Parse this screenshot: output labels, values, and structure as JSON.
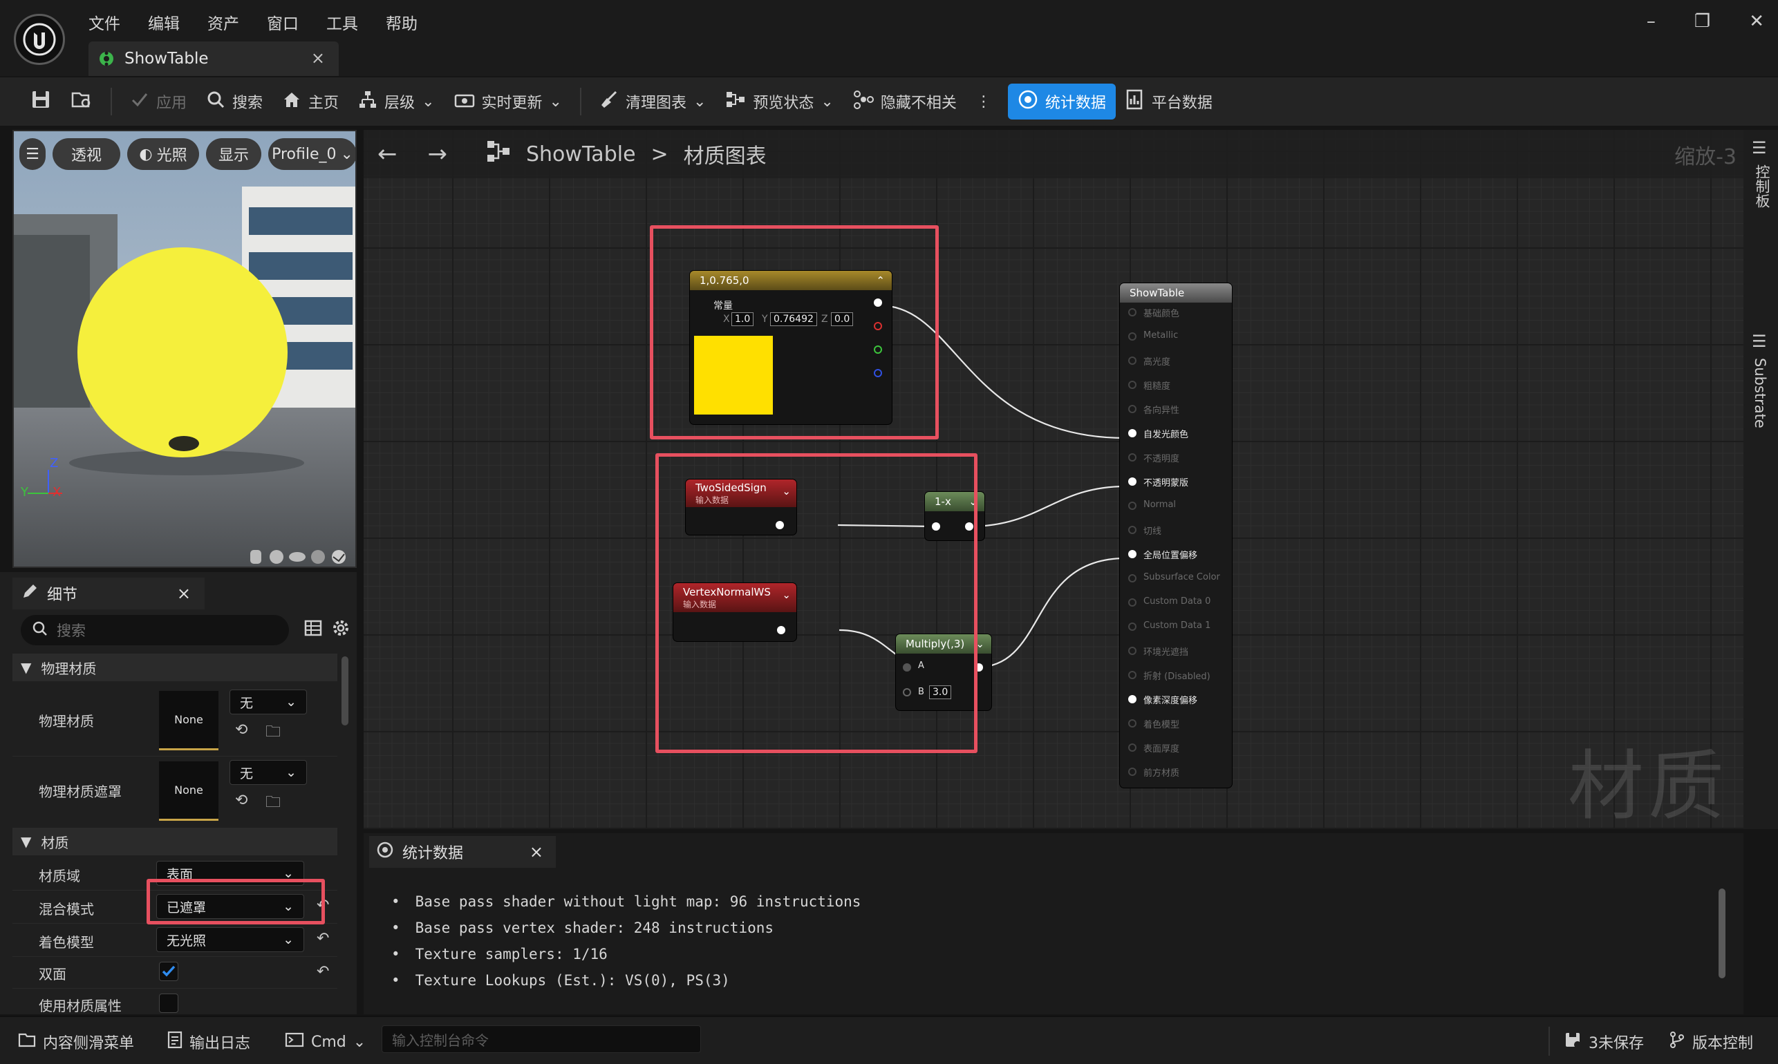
{
  "app": {
    "title": "ShowTable"
  },
  "menu": [
    "文件",
    "编辑",
    "资产",
    "窗口",
    "工具",
    "帮助"
  ],
  "toolbar": {
    "apply": "应用",
    "search": "搜索",
    "home": "主页",
    "hierarchy": "层级",
    "live_update": "实时更新",
    "clean_graph": "清理图表",
    "preview_state": "预览状态",
    "hide_unrelated": "隐藏不相关",
    "stats": "统计数据",
    "platform_stats": "平台数据"
  },
  "viewport": {
    "perspective": "透视",
    "lighting": "光照",
    "show": "显示",
    "profile": "Profile_0",
    "axes": {
      "z": "Z",
      "y": "Y",
      "x": "X"
    }
  },
  "details": {
    "tab": "细节",
    "search_placeholder": "搜索",
    "physical_section": "物理材质",
    "phys_mat_label": "物理材质",
    "phys_mat_value": "None",
    "phys_mat_option": "无",
    "phys_mask_label": "物理材质遮罩",
    "phys_mask_value": "None",
    "phys_mask_option": "无",
    "material_section": "材质",
    "domain_label": "材质域",
    "domain_value": "表面",
    "blend_label": "混合模式",
    "blend_value": "已遮罩",
    "shading_label": "着色模型",
    "shading_value": "无光照",
    "two_sided_label": "双面",
    "two_sided": true,
    "use_attrs_label": "使用材质属性"
  },
  "graph": {
    "breadcrumb_root": "ShowTable",
    "breadcrumb_sep": ">",
    "breadcrumb_leaf": "材质图表",
    "zoom": "缩放-3",
    "watermark": "材质",
    "constant_node": {
      "title": "1,0.765,0",
      "label": "常量",
      "x_label": "X",
      "x": "1.0",
      "y_label": "Y",
      "y": "0.76492",
      "z_label": "Z",
      "z": "0.0",
      "color": "#ffe000"
    },
    "twosided_node": {
      "title": "TwoSidedSign",
      "sub": "输入数据"
    },
    "vertexnormal_node": {
      "title": "VertexNormalWS",
      "sub": "输入数据"
    },
    "oneminus_node": {
      "title": "1-x"
    },
    "multiply_node": {
      "title": "Multiply(,3)",
      "a": "A",
      "b": "B",
      "b_value": "3.0"
    },
    "result_node": {
      "title": "ShowTable",
      "pins": [
        {
          "label": "基础颜色",
          "active": false
        },
        {
          "label": "Metallic",
          "active": false
        },
        {
          "label": "高光度",
          "active": false
        },
        {
          "label": "粗糙度",
          "active": false
        },
        {
          "label": "各向异性",
          "active": false
        },
        {
          "label": "自发光颜色",
          "active": true
        },
        {
          "label": "不透明度",
          "active": false
        },
        {
          "label": "不透明蒙版",
          "active": true
        },
        {
          "label": "Normal",
          "active": false
        },
        {
          "label": "切线",
          "active": false
        },
        {
          "label": "全局位置偏移",
          "active": true
        },
        {
          "label": "Subsurface Color",
          "active": false
        },
        {
          "label": "Custom Data 0",
          "active": false
        },
        {
          "label": "Custom Data 1",
          "active": false
        },
        {
          "label": "环境光遮挡",
          "active": false
        },
        {
          "label": "折射 (Disabled)",
          "active": false
        },
        {
          "label": "像素深度偏移",
          "active": true
        },
        {
          "label": "着色模型",
          "active": false
        },
        {
          "label": "表面厚度",
          "active": false
        },
        {
          "label": "前方材质",
          "active": false
        }
      ]
    }
  },
  "side_tabs": {
    "palette": "控制板",
    "substrate": "Substrate"
  },
  "stats": {
    "tab": "统计数据",
    "lines": [
      "Base pass shader without light map: 96 instructions",
      "Base pass vertex shader: 248 instructions",
      "Texture samplers: 1/16",
      "Texture Lookups (Est.): VS(0), PS(3)"
    ]
  },
  "statusbar": {
    "content_drawer": "内容侧滑菜单",
    "output_log": "输出日志",
    "cmd": "Cmd",
    "console_placeholder": "输入控制台命令",
    "unsaved": "3未保存",
    "source_control": "版本控制"
  },
  "colors": {
    "accent": "#1e88e5",
    "highlight": "#e7505f",
    "input_node": "#a01e24",
    "oneminus_node": "#5a7a4a",
    "constant_node": "#a88a2a"
  }
}
